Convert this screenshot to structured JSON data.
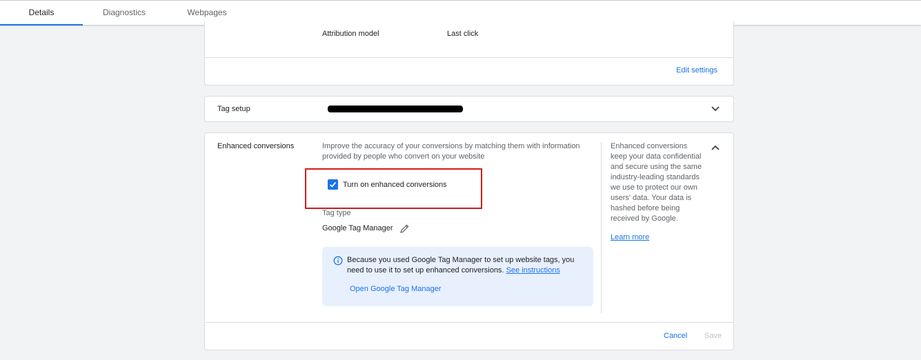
{
  "tabs": [
    {
      "label": "Details",
      "active": true
    },
    {
      "label": "Diagnostics",
      "active": false
    },
    {
      "label": "Webpages",
      "active": false
    }
  ],
  "attribution": {
    "label": "Attribution model",
    "value": "Last click",
    "edit_link": "Edit settings"
  },
  "tag_setup": {
    "label": "Tag setup"
  },
  "enhanced": {
    "label": "Enhanced conversions",
    "description_line1": "Improve the accuracy of your conversions by matching them with information",
    "description_line2": "provided by people who convert on your website",
    "checkbox_label": "Turn on enhanced conversions",
    "checkbox_checked": true,
    "tag_type_label": "Tag type",
    "tag_type_value": "Google Tag Manager",
    "info_line1": "Because you used Google Tag Manager to set up website tags, you",
    "info_line2": "need to use it to set up enhanced conversions.",
    "info_link": "See instructions",
    "open_gtm_link": "Open Google Tag Manager",
    "side_lines": [
      "Enhanced conversions",
      "keep your data confidential",
      "and secure using the same",
      "industry-leading standards",
      "we use to protect our own",
      "users' data. Your data is",
      "hashed before being",
      "received by Google."
    ],
    "learn_more": "Learn more",
    "cancel_label": "Cancel",
    "save_label": "Save"
  },
  "colors": {
    "accent": "#1a73e8",
    "highlight_border": "#d21a1a",
    "info_bg": "#e8f0fe"
  }
}
